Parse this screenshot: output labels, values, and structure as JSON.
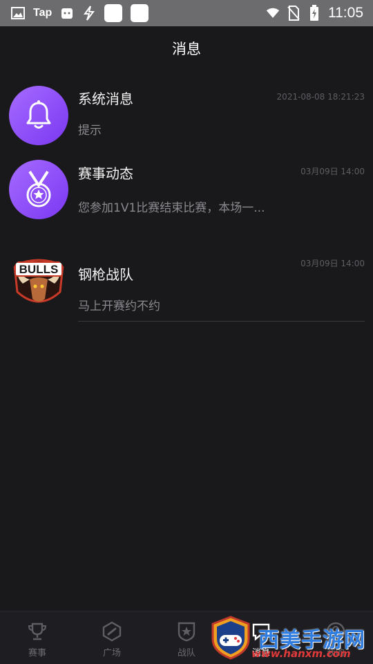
{
  "status_bar": {
    "left_icons": [
      "image-icon",
      "taptap-icon",
      "calendar-icon",
      "bolt-icon",
      "app-square-icon",
      "app-square-icon"
    ],
    "tap_label": "Tap",
    "right_icons": [
      "wifi-icon",
      "no-sim-icon",
      "battery-charging-icon"
    ],
    "time": "11:05"
  },
  "header": {
    "title": "消息"
  },
  "messages": [
    {
      "title": "系统消息",
      "time": "2021-08-08 18:21:23",
      "preview": "提示",
      "avatar": "bell-icon"
    },
    {
      "title": "赛事动态",
      "time": "03月09日 14:00",
      "preview": "您参加1V1比赛结束比赛，本场一...",
      "avatar": "medal-icon"
    },
    {
      "title": "钢枪战队",
      "time": "03月09日 14:00",
      "preview": "马上开赛约不约",
      "avatar": "bulls-team-logo",
      "logo_text": "BULLS"
    }
  ],
  "bottom_nav": {
    "items": [
      {
        "label": "赛事",
        "icon": "trophy-icon",
        "active": false
      },
      {
        "label": "广场",
        "icon": "compass-icon",
        "active": false
      },
      {
        "label": "战队",
        "icon": "shield-star-icon",
        "active": false
      },
      {
        "label": "消息",
        "icon": "message-icon",
        "active": true
      },
      {
        "label": "我的",
        "icon": "profile-icon",
        "active": false
      }
    ]
  },
  "watermark": {
    "text": "西美手游网",
    "url": "www.hanxm.com"
  },
  "colors": {
    "background": "#19191c",
    "status_bar": "#6c6c6e",
    "avatar_purple": "#8a4af5",
    "nav_bg": "#1e1e22"
  }
}
